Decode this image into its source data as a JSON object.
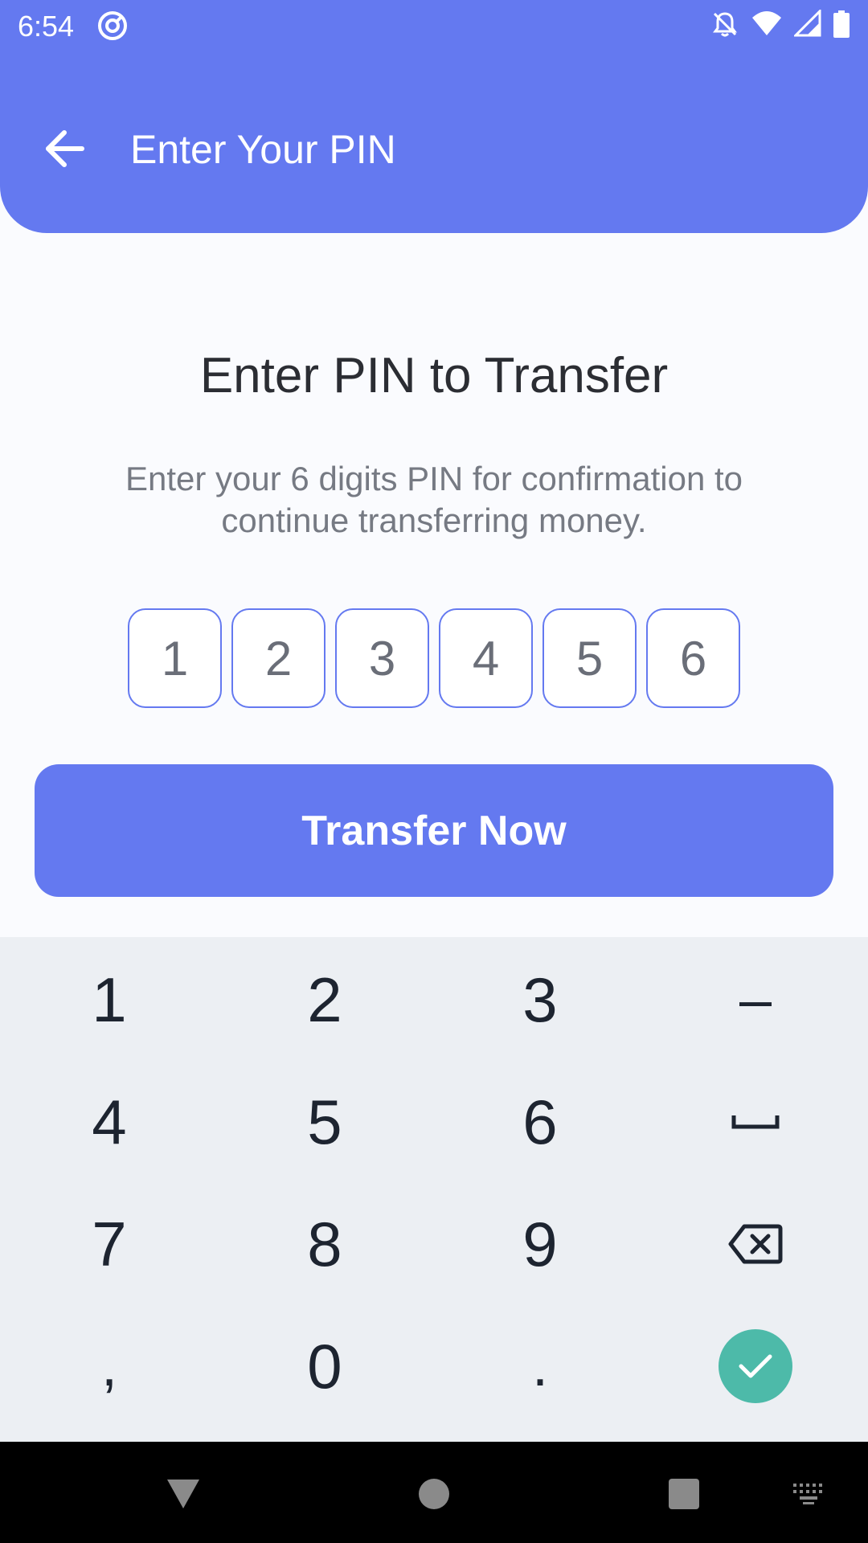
{
  "status": {
    "time": "6:54"
  },
  "header": {
    "title": "Enter Your PIN"
  },
  "main": {
    "heading": "Enter PIN to Transfer",
    "description": "Enter your 6 digits PIN for confirmation to continue transferring money.",
    "pin_digits": [
      "1",
      "2",
      "3",
      "4",
      "5",
      "6"
    ],
    "cta_label": "Transfer Now"
  },
  "keyboard": {
    "keys": [
      "1",
      "2",
      "3",
      "–",
      "4",
      "5",
      "6",
      "space-icon",
      "7",
      "8",
      "9",
      "backspace-icon",
      ",",
      "0",
      ".",
      "check-icon"
    ]
  },
  "colors": {
    "accent": "#6479f0",
    "confirm": "#4dbaa9",
    "keyboard_bg": "#eceff3"
  }
}
